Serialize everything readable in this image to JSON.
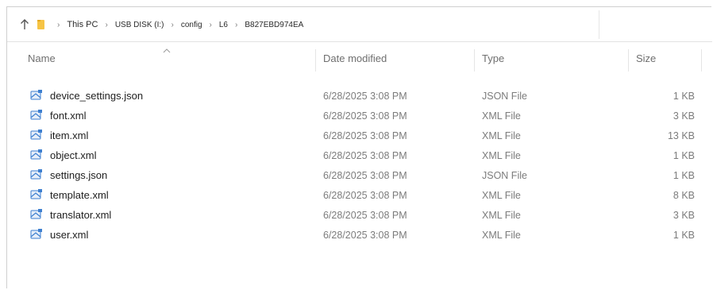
{
  "address_bar": {
    "breadcrumbs": [
      {
        "label": "This PC"
      },
      {
        "label": "USB DISK (I:)"
      },
      {
        "label": "config"
      },
      {
        "label": "L6"
      },
      {
        "label": "B827EBD974EA"
      }
    ]
  },
  "columns": {
    "name": "Name",
    "date": "Date modified",
    "type": "Type",
    "size": "Size"
  },
  "files": [
    {
      "name": "device_settings.json",
      "date": "6/28/2025 3:08 PM",
      "type": "JSON File",
      "size": "1 KB"
    },
    {
      "name": "font.xml",
      "date": "6/28/2025 3:08 PM",
      "type": "XML File",
      "size": "3 KB"
    },
    {
      "name": "item.xml",
      "date": "6/28/2025 3:08 PM",
      "type": "XML File",
      "size": "13 KB"
    },
    {
      "name": "object.xml",
      "date": "6/28/2025 3:08 PM",
      "type": "XML File",
      "size": "1 KB"
    },
    {
      "name": "settings.json",
      "date": "6/28/2025 3:08 PM",
      "type": "JSON File",
      "size": "1 KB"
    },
    {
      "name": "template.xml",
      "date": "6/28/2025 3:08 PM",
      "type": "XML File",
      "size": "8 KB"
    },
    {
      "name": "translator.xml",
      "date": "6/28/2025 3:08 PM",
      "type": "XML File",
      "size": "3 KB"
    },
    {
      "name": "user.xml",
      "date": "6/28/2025 3:08 PM",
      "type": "XML File",
      "size": "1 KB"
    }
  ],
  "icons": {
    "up": "arrow-up-icon",
    "folder": "folder-icon",
    "separator": "chevron-right-icon",
    "sort": "sort-ascending-icon",
    "file": "document-file-icon"
  },
  "colors": {
    "folder_yellow": "#f6c445",
    "file_icon_blue": "#3d7fd0",
    "header_text": "#6f6f6f",
    "secondary_text": "#7c7c7c"
  }
}
